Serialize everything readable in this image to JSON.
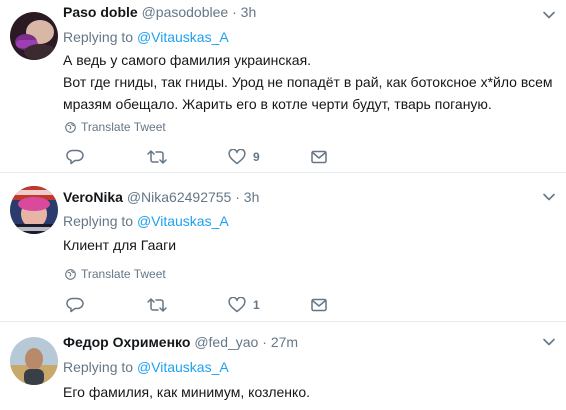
{
  "tweets": [
    {
      "name": "Paso doble",
      "handle": "@pasodoblee",
      "separator": "·",
      "time": "3h",
      "replying_prefix": "Replying to",
      "replying_handle": "@Vitauskas_A",
      "lines": [
        "А ведь у самого фамилия украинская.",
        "Вот где гниды, так гниды. Урод не попадёт в рай, как ботоксное х*йло всем",
        "мразям обещало. Жарить его в котле черти будут, тварь поганую."
      ],
      "translate_label": "Translate Tweet",
      "likes": "9"
    },
    {
      "name": "VeroNika",
      "handle": "@Nika62492755",
      "separator": "·",
      "time": "3h",
      "replying_prefix": "Replying to",
      "replying_handle": "@Vitauskas_A",
      "lines": [
        "Клиент для Гааги"
      ],
      "translate_label": "Translate Tweet",
      "likes": "1"
    },
    {
      "name": "Федор Охрименко",
      "handle": "@fed_yao",
      "separator": "·",
      "time": "27m",
      "replying_prefix": "Replying to",
      "replying_handle": "@Vitauskas_A",
      "lines": [
        "Его фамилия, как минимум, козленко."
      ]
    }
  ],
  "icons": {
    "reply": "reply-icon",
    "retweet": "retweet-icon",
    "like": "heart-icon",
    "dm": "message-icon",
    "more": "chevron-down-icon",
    "translate": "globe-icon"
  },
  "colors": {
    "link": "#1da1f2",
    "muted": "#657786",
    "text": "#14171a",
    "divider": "#e6ecf0"
  }
}
